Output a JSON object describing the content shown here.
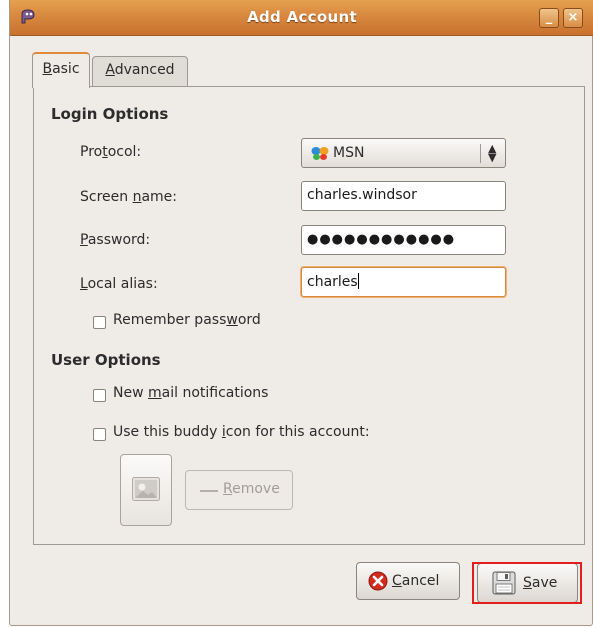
{
  "window": {
    "title": "Add Account",
    "title_icon": "pidgin-icon",
    "minimize_glyph": "_",
    "close_glyph": "×"
  },
  "tabs": [
    {
      "label": "Basic",
      "mnemonic": "B",
      "rest": "asic",
      "selected": true
    },
    {
      "label": "Advanced",
      "mnemonic": "A",
      "rest": "dvanced",
      "selected": false
    }
  ],
  "login_options": {
    "title": "Login Options",
    "protocol": {
      "label_pre": "Pro",
      "mnemonic": "t",
      "label_post": "ocol:",
      "value": "MSN",
      "icon": "msn-butterfly-icon"
    },
    "screen_name": {
      "label_pre": "Screen ",
      "mnemonic": "n",
      "label_post": "ame:",
      "value": "charles.windsor"
    },
    "password": {
      "label_pre": "",
      "mnemonic": "P",
      "label_post": "assword:",
      "value": "●●●●●●●●●●●●"
    },
    "local_alias": {
      "label_pre": "",
      "mnemonic": "L",
      "label_post": "ocal alias:",
      "value": "charles"
    },
    "remember_password": {
      "label_pre": "Remember pass",
      "mnemonic": "w",
      "label_post": "ord",
      "checked": false
    }
  },
  "user_options": {
    "title": "User Options",
    "new_mail": {
      "label_pre": "New ",
      "mnemonic": "m",
      "label_post": "ail notifications",
      "checked": false
    },
    "buddy_icon": {
      "label_pre": "Use this buddy ",
      "mnemonic": "i",
      "label_post": "con for this account:",
      "checked": false
    },
    "remove_button": {
      "label_pre": "",
      "mnemonic": "R",
      "label_post": "emove",
      "enabled": false
    }
  },
  "buttons": {
    "cancel": {
      "label_pre": "",
      "mnemonic": "C",
      "label_post": "ancel",
      "icon": "cancel-icon"
    },
    "save": {
      "label_pre": "",
      "mnemonic": "S",
      "label_post": "ave",
      "icon": "floppy-disk-icon"
    }
  },
  "colors": {
    "titlebar": "#d98840",
    "focus_ring": "#d9883f",
    "highlight_box": "#e0201c",
    "cancel_icon_red": "#d42a1e"
  }
}
